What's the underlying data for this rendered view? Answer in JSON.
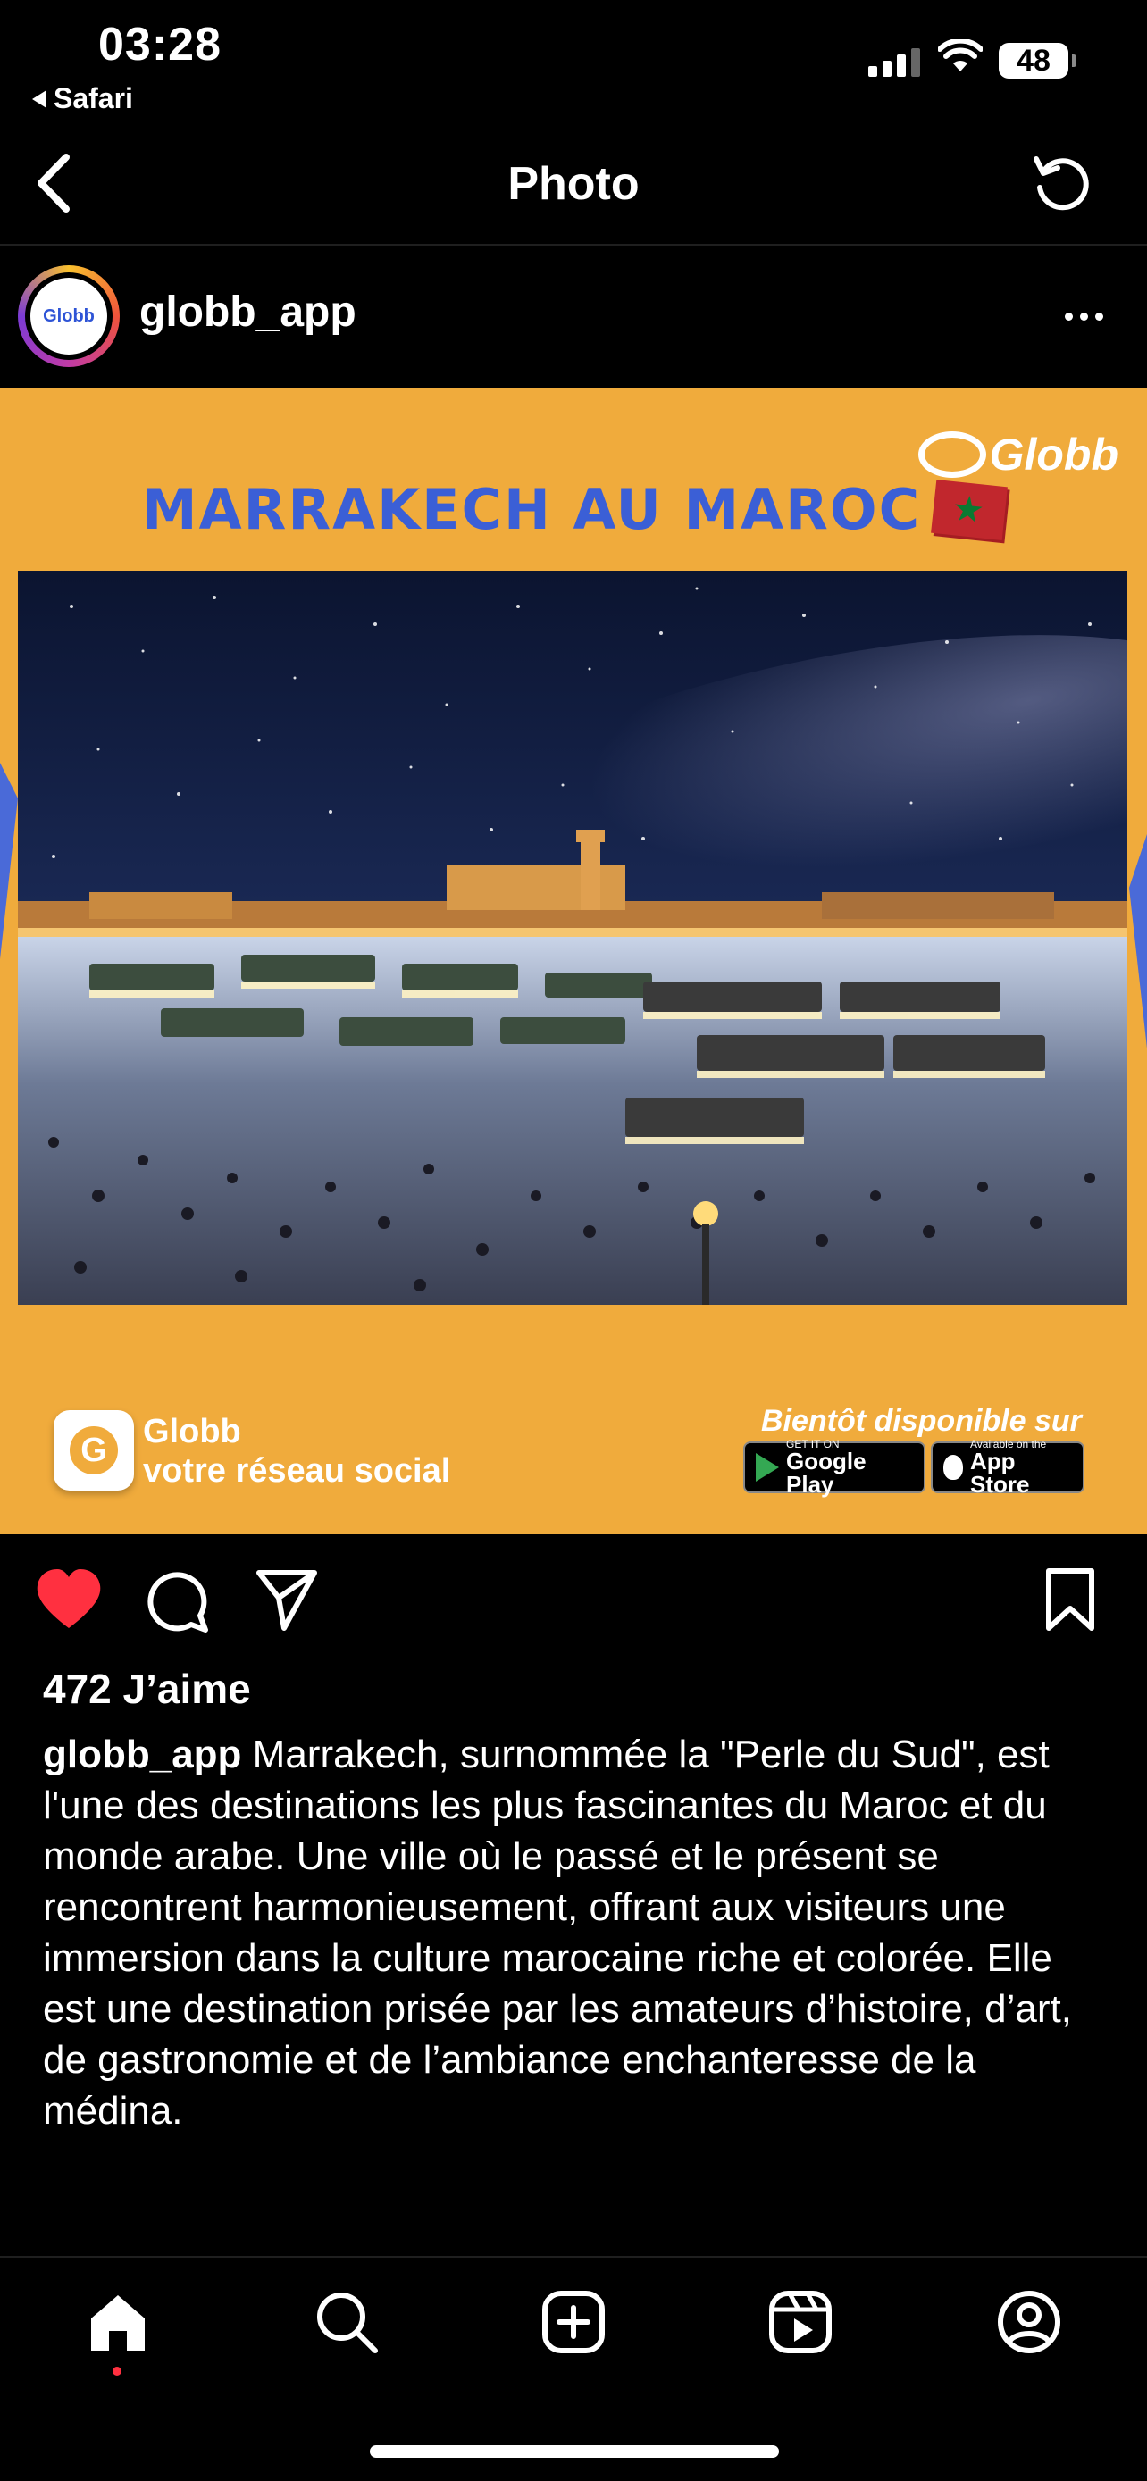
{
  "status_bar": {
    "time": "03:28",
    "back_app": "Safari",
    "battery": "48"
  },
  "nav": {
    "title": "Photo"
  },
  "post": {
    "username": "globb_app",
    "avatar_text": "Globb",
    "image": {
      "brand": "Globb",
      "headline": "MARRAKECH AU MAROC",
      "app_name": "Globb",
      "app_tagline": "votre réseau social",
      "availability": "Bientôt disponible sur",
      "google_play_small": "GET IT ON",
      "google_play_big": "Google Play",
      "app_store_small": "Available on the",
      "app_store_big": "App Store"
    },
    "likes": "472 J’aime",
    "caption_user": "globb_app",
    "caption_text": " Marrakech, surnommée la \"Perle du Sud\", est l'une des destinations les plus fascinantes du Maroc et du monde arabe. Une ville où le passé et le présent se rencontrent harmonieusement, offrant aux visiteurs une immersion dans la culture marocaine riche et colorée. Elle est une destination prisée par les amateurs d’histoire, d’art, de gastronomie et de l’ambiance enchanteresse de la médina."
  },
  "colors": {
    "accent_red": "#ff3040",
    "banner_orange": "#f0ab3c",
    "headline_blue": "#3b5fd6"
  },
  "icons": [
    "back-chevron-icon",
    "refresh-icon",
    "more-icon",
    "heart-icon",
    "comment-icon",
    "share-icon",
    "bookmark-icon",
    "home-icon",
    "search-icon",
    "add-icon",
    "reels-icon",
    "profile-icon"
  ]
}
